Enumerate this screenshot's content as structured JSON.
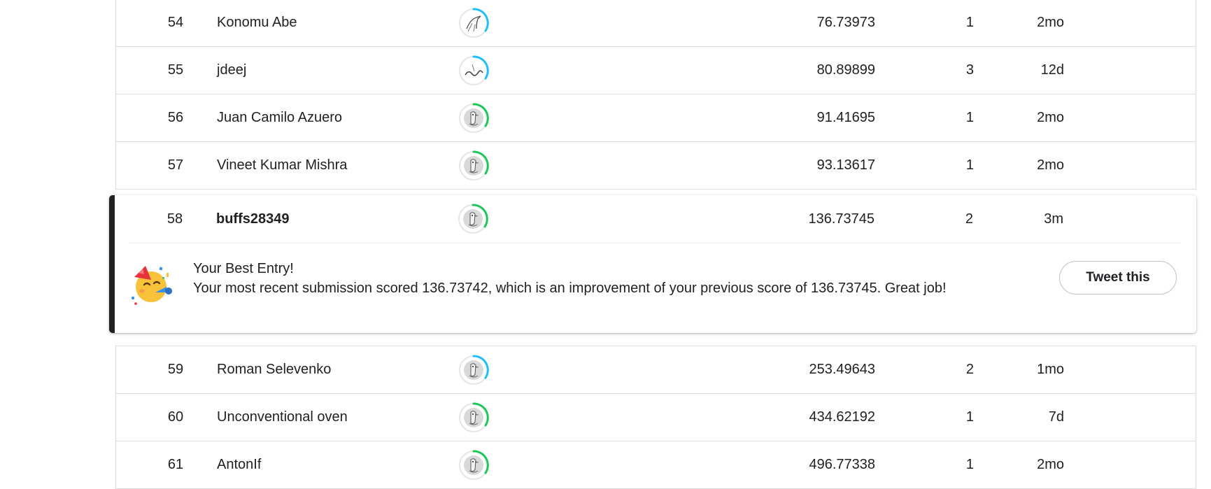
{
  "leaderboard": {
    "rows_above": [
      {
        "rank": "54",
        "name": "Konomu Abe",
        "score": "76.73973",
        "entries": "1",
        "last": "2mo",
        "tier_color": "#20beff",
        "avatar": "bird-sketch-icon"
      },
      {
        "rank": "55",
        "name": "jdeej",
        "score": "80.89899",
        "entries": "3",
        "last": "12d",
        "tier_color": "#20beff",
        "avatar": "scribble-icon"
      },
      {
        "rank": "56",
        "name": "Juan Camilo Azuero",
        "score": "91.41695",
        "entries": "1",
        "last": "2mo",
        "tier_color": "#20c65a",
        "avatar": "goose-icon"
      },
      {
        "rank": "57",
        "name": "Vineet Kumar Mishra",
        "score": "93.13617",
        "entries": "1",
        "last": "2mo",
        "tier_color": "#20c65a",
        "avatar": "goose-icon"
      }
    ],
    "current_user": {
      "rank": "58",
      "name": "buffs28349",
      "score": "136.73745",
      "entries": "2",
      "last": "3m",
      "tier_color": "#20c65a",
      "avatar": "goose-icon",
      "message": {
        "emoji": "party-face-icon",
        "title": "Your Best Entry!",
        "body": "Your most recent submission scored 136.73742, which is an improvement of your previous score of 136.73745. Great job!",
        "tweet_label": "Tweet this"
      }
    },
    "rows_below": [
      {
        "rank": "59",
        "name": "Roman Selevenko",
        "score": "253.49643",
        "entries": "2",
        "last": "1mo",
        "tier_color": "#20beff",
        "avatar": "goose-icon"
      },
      {
        "rank": "60",
        "name": "Unconventional oven",
        "score": "434.62192",
        "entries": "1",
        "last": "7d",
        "tier_color": "#20c65a",
        "avatar": "goose-icon"
      },
      {
        "rank": "61",
        "name": "AntonIf",
        "score": "496.77338",
        "entries": "1",
        "last": "2mo",
        "tier_color": "#20c65a",
        "avatar": "goose-icon"
      }
    ]
  },
  "colors": {
    "accent_bar": "#202124",
    "novice": "#20c65a",
    "contributor": "#20beff",
    "border": "#dadce0"
  }
}
